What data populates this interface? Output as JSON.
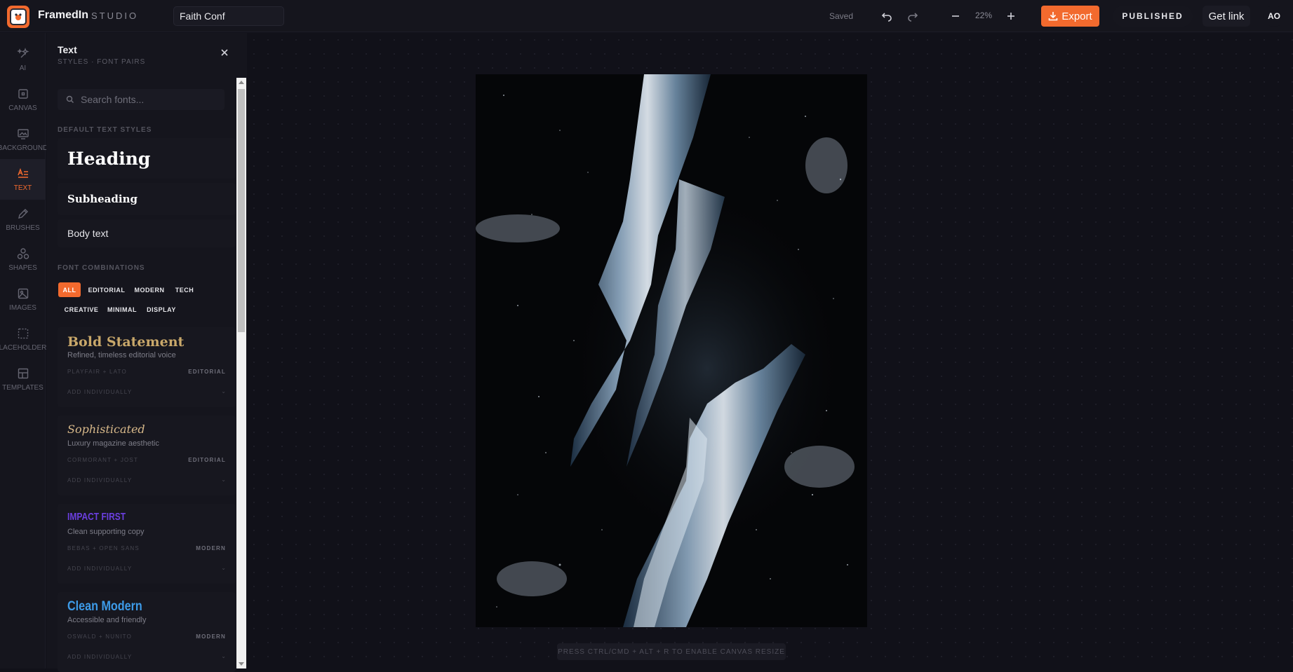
{
  "app": {
    "brand": "FramedIn",
    "brand_sub": "STUDIO",
    "document_title": "Faith Conf",
    "save_status": "Saved",
    "zoom": "22%",
    "export_label": "Export",
    "published_label": "PUBLISHED",
    "get_link_label": "Get link",
    "avatar_initials": "AO",
    "accent": "#f26a2e"
  },
  "rail": {
    "items": [
      {
        "label": "AI",
        "icon": "sparkles-icon"
      },
      {
        "label": "CANVAS",
        "icon": "square-icon"
      },
      {
        "label": "BACKGROUND",
        "icon": "image-frame-icon"
      },
      {
        "label": "TEXT",
        "icon": "text-lines-icon",
        "active": true
      },
      {
        "label": "BRUSHES",
        "icon": "pen-icon"
      },
      {
        "label": "SHAPES",
        "icon": "shapes-icon"
      },
      {
        "label": "IMAGES",
        "icon": "image-icon"
      },
      {
        "label": "PLACEHOLDERS",
        "icon": "dashed-square-icon"
      },
      {
        "label": "TEMPLATES",
        "icon": "layout-icon"
      }
    ]
  },
  "panel": {
    "title": "Text",
    "subtitle": "STYLES · FONT PAIRS",
    "search_placeholder": "Search fonts...",
    "default_styles_label": "DEFAULT TEXT STYLES",
    "styles": {
      "heading": "Heading",
      "subheading": "Subheading",
      "body": "Body text"
    },
    "combos_label": "FONT COMBINATIONS",
    "filters": [
      "ALL",
      "EDITORIAL",
      "MODERN",
      "TECH",
      "CREATIVE",
      "MINIMAL",
      "DISPLAY"
    ],
    "combos": [
      {
        "name": "Bold Statement",
        "desc": "Refined, timeless editorial voice",
        "fonts": "PLAYFAIR + LATO",
        "category": "EDITORIAL",
        "add": "ADD INDIVIDUALLY",
        "chevron": "⌄",
        "color": "#c9a86a"
      },
      {
        "name": "Sophisticated",
        "desc": "Luxury magazine aesthetic",
        "fonts": "CORMORANT + JOST",
        "category": "EDITORIAL",
        "add": "ADD INDIVIDUALLY",
        "chevron": "⌄",
        "color": "#d8b98a"
      },
      {
        "name": "IMPACT FIRST",
        "desc": "Clean supporting copy",
        "fonts": "BEBAS + OPEN SANS",
        "category": "MODERN",
        "add": "ADD INDIVIDUALLY",
        "chevron": "⌄",
        "color": "#6b3fe0"
      },
      {
        "name": "Clean Modern",
        "desc": "Accessible and friendly",
        "fonts": "OSWALD + NUNITO",
        "category": "MODERN",
        "add": "ADD INDIVIDUALLY",
        "chevron": "⌄",
        "color": "#3d9be8"
      }
    ]
  },
  "canvas": {
    "hint": "PRESS CTRL/CMD + ALT + R TO ENABLE CANVAS RESIZE"
  }
}
